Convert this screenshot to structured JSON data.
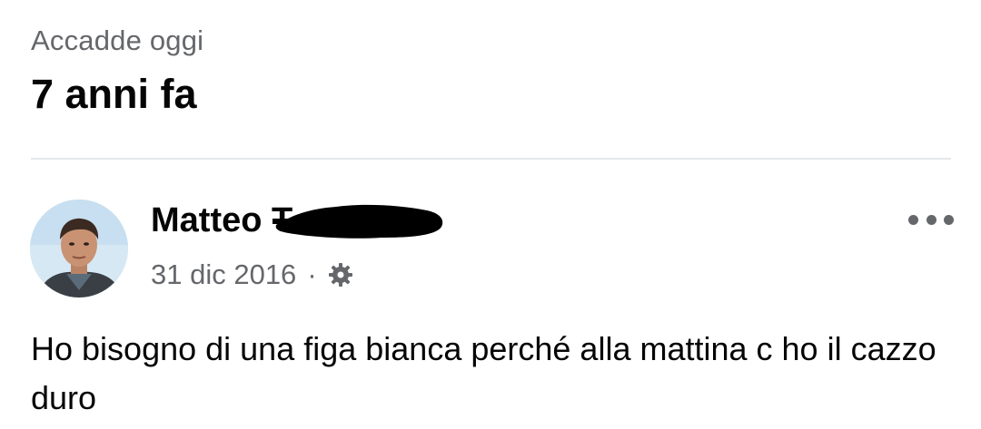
{
  "memory": {
    "kicker": "Accadde oggi",
    "title": "7 anni fa"
  },
  "post": {
    "author_name": "Matteo T",
    "date": "31 dic 2016",
    "separator": "·",
    "privacy_icon": "gear-icon",
    "more_icon": "more-horizontal-icon",
    "text": "Ho bisogno di una figa bianca perché alla mattina c ho il cazzo duro"
  },
  "colors": {
    "primary_text": "#050505",
    "secondary_text": "#65676b",
    "divider": "#e4e6eb"
  }
}
